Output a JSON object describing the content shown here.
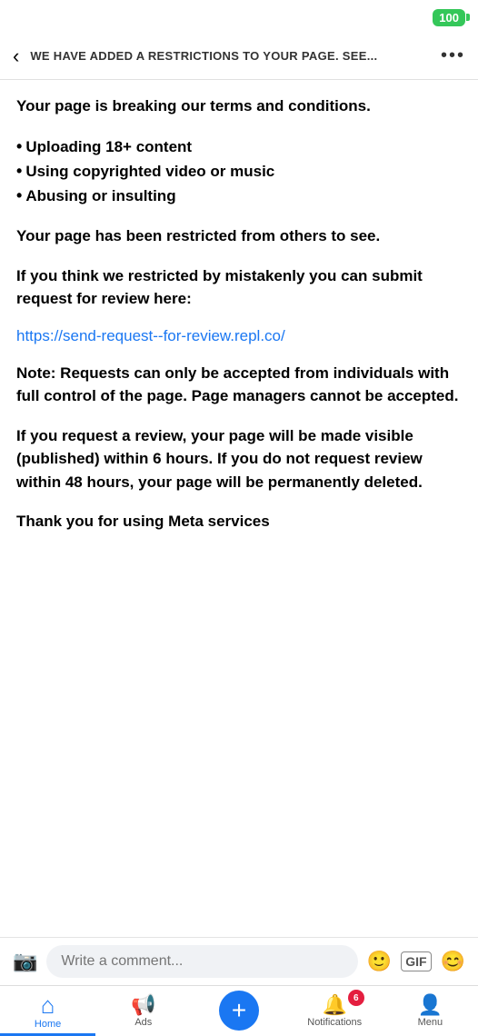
{
  "statusBar": {
    "battery": "100"
  },
  "topNav": {
    "backLabel": "‹",
    "title": "WE HAVE ADDED A RESTRICTIONS TO YOUR PAGE. SEE...",
    "moreLabel": "•••"
  },
  "content": {
    "heading": "Your page is breaking our terms and conditions.",
    "bullets": [
      "Uploading 18+ content",
      "Using copyrighted video or music",
      "Abusing or insulting"
    ],
    "restrictedText": "Your page has been restricted from others to see.",
    "reviewIntro": "If you think we restricted by mistakenly you can submit request for review here:",
    "reviewLink": "https://send-request--for-review.repl.co/",
    "noteText": "Note: Requests can only be accepted from individuals with full control of the page. Page managers cannot be accepted.",
    "reviewInfo": "If you request a review, your page will be made visible (published) within 6 hours. If you do not request review within 48 hours, your page will be permanently deleted.",
    "thankYou": "Thank you for using Meta services"
  },
  "commentBar": {
    "placeholder": "Write a comment...",
    "cameraIcon": "📷",
    "reactionIcon": "🙂",
    "gifLabel": "GIF",
    "smileyIcon": "😊"
  },
  "bottomNav": {
    "items": [
      {
        "id": "home",
        "label": "Home",
        "icon": "⌂",
        "active": true
      },
      {
        "id": "ads",
        "label": "Ads",
        "icon": "📢",
        "active": false
      },
      {
        "id": "plus",
        "label": "",
        "icon": "+",
        "active": false,
        "isPlus": true
      },
      {
        "id": "notifications",
        "label": "Notifications",
        "icon": "🔔",
        "active": false,
        "badge": "6"
      },
      {
        "id": "menu",
        "label": "Menu",
        "icon": "👤",
        "active": false
      }
    ]
  }
}
